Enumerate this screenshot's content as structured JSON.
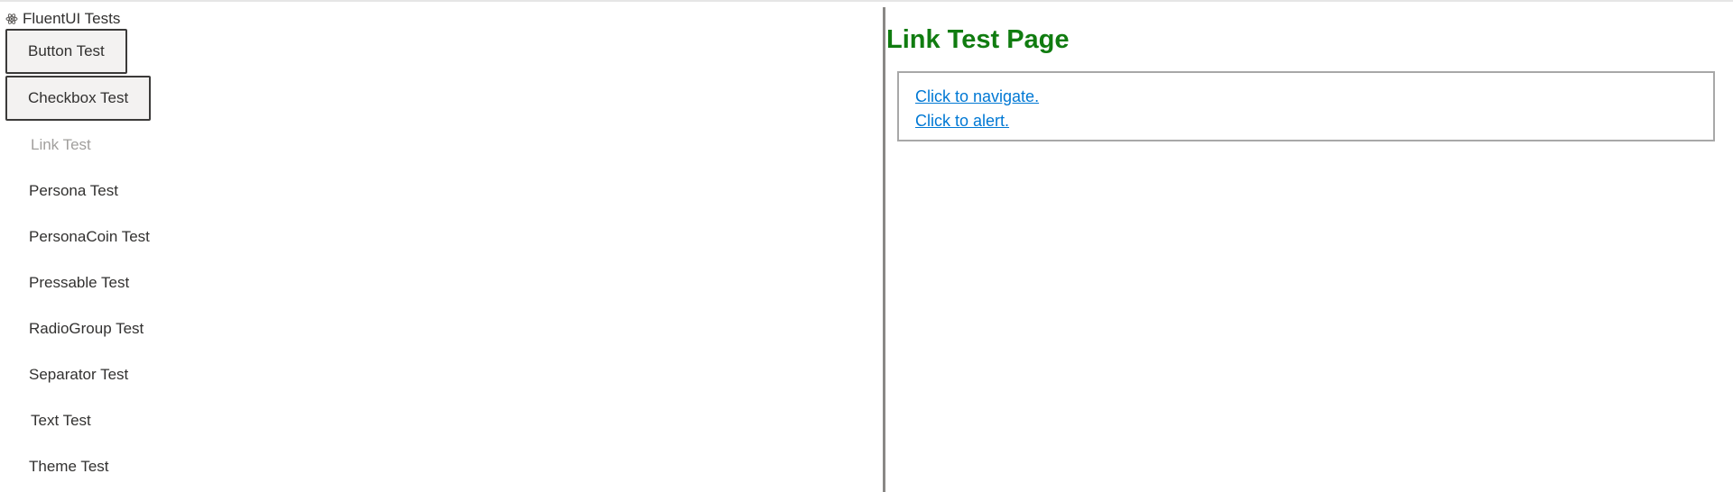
{
  "app": {
    "title": "FluentUI Tests",
    "icon": "react-atom-icon"
  },
  "sidebar": {
    "items": [
      {
        "label": "Button Test",
        "state": "boxed"
      },
      {
        "label": "Checkbox Test",
        "state": "boxed"
      },
      {
        "label": "Link Test",
        "state": "disabled"
      },
      {
        "label": "Persona Test",
        "state": "normal"
      },
      {
        "label": "PersonaCoin Test",
        "state": "normal"
      },
      {
        "label": "Pressable Test",
        "state": "normal"
      },
      {
        "label": "RadioGroup Test",
        "state": "normal"
      },
      {
        "label": "Separator Test",
        "state": "normal"
      },
      {
        "label": "Text Test",
        "state": "normal"
      },
      {
        "label": "Theme Test",
        "state": "normal"
      }
    ]
  },
  "main": {
    "title": "Link Test Page",
    "links": [
      {
        "label": "Click to navigate."
      },
      {
        "label": "Click to alert."
      }
    ]
  },
  "colors": {
    "title_green": "#107c10",
    "link_blue": "#0078d4",
    "divider": "#8a8886"
  }
}
